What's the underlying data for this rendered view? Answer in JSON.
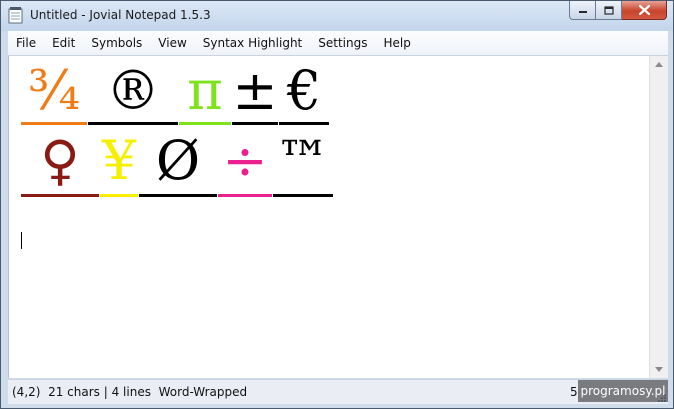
{
  "window": {
    "title": "Untitled - Jovial Notepad 1.5.3",
    "icon": "notepad-app-icon"
  },
  "caption_buttons": {
    "minimize_icon": "minimize-icon",
    "maximize_icon": "maximize-icon",
    "close_icon": "close-icon"
  },
  "menu": {
    "items": [
      "File",
      "Edit",
      "Symbols",
      "View",
      "Syntax Highlight",
      "Settings",
      "Help"
    ]
  },
  "editor": {
    "lines": [
      [
        {
          "char": "¾",
          "color": "#ee7d18",
          "underline": "#ee7d18"
        },
        {
          "char": "®",
          "color": "#000000",
          "underline": "#000000"
        },
        {
          "char": "π",
          "color": "#7ee31c",
          "underline": "#7ee31c"
        },
        {
          "char": "±",
          "color": "#000000",
          "underline": "#000000"
        },
        {
          "char": "€",
          "color": "#000000",
          "underline": "#000000"
        }
      ],
      [
        {
          "char": "♀",
          "color": "#8a1a14",
          "underline": "#8a1a14"
        },
        {
          "char": "¥",
          "color": "#f6f000",
          "underline": "#f6f000"
        },
        {
          "char": "Ø",
          "color": "#000000",
          "underline": "#000000"
        },
        {
          "char": "÷",
          "color": "#ec1f8e",
          "underline": "#ec1f8e"
        },
        {
          "char": "™",
          "color": "#000000",
          "underline": "#000000"
        }
      ]
    ]
  },
  "status": {
    "position": "(4,2)",
    "chars": "21 chars",
    "lines": "4 lines",
    "wrap": "Word-Wrapped",
    "right": "5"
  },
  "watermark": "programosy.pl"
}
